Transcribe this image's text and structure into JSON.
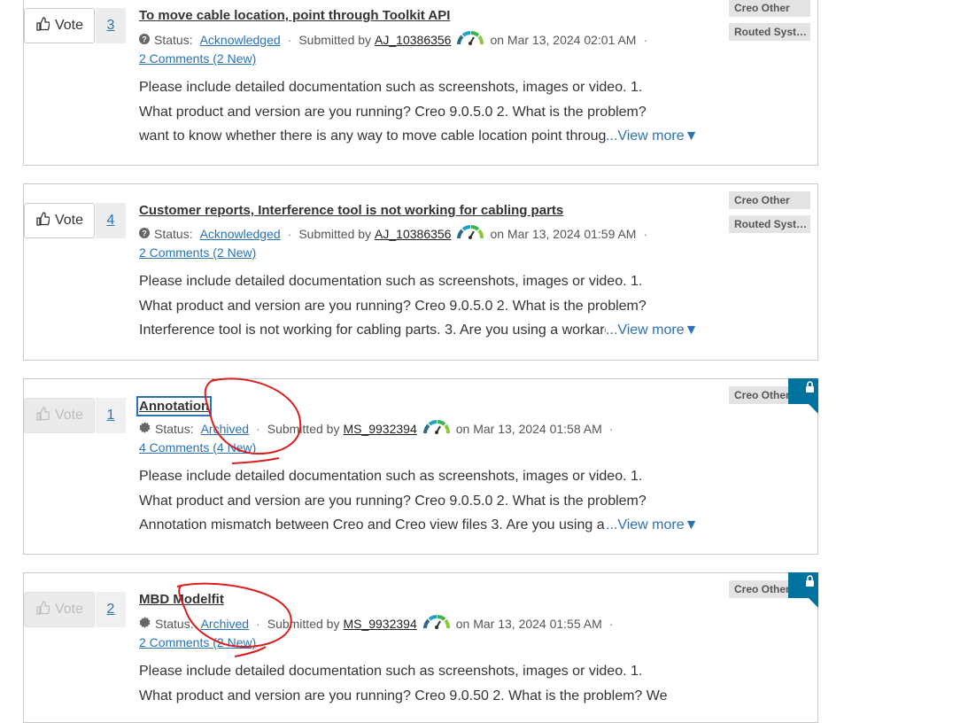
{
  "ideas": [
    {
      "vote_label": "Vote",
      "count": "3",
      "title": "To move cable location, point through Toolkit API",
      "status_label": "Status:",
      "status": "Acknowledged",
      "submitted_by_label": "Submitted by",
      "user": "AJ_10386356",
      "date": "on Mar 13, 2024 02:01 AM",
      "comments": "2 Comments (2 New)",
      "body_lines": [
        "Please include detailed documentation such as screenshots, images or video. 1.",
        "What product and version are you running? Creo 9.0.5.0 2. What is the problem?",
        "want to know whether there is any way to move cable location point through TOOLKIT"
      ],
      "view_more": "...View more",
      "labels": [
        "Creo Other",
        "Routed Systems Designer"
      ]
    },
    {
      "vote_label": "Vote",
      "count": "4",
      "title": "Customer reports, Interference tool is not working for cabling parts",
      "status_label": "Status:",
      "status": "Acknowledged",
      "submitted_by_label": "Submitted by",
      "user": "AJ_10386356",
      "date": "on Mar 13, 2024 01:59 AM",
      "comments": "2 Comments (2 New)",
      "body_lines": [
        "Please include detailed documentation such as screenshots, images or video. 1.",
        "What product and version are you running? Creo 9.0.5.0 2. What is the problem?",
        "Interference tool is not working for cabling parts. 3. Are you using a workaround"
      ],
      "view_more": "...View more",
      "labels": [
        "Creo Other",
        "Routed Systems Designer"
      ]
    },
    {
      "vote_label": "Vote",
      "count": "1",
      "title": "Annotation",
      "status_label": "Status:",
      "status": "Archived",
      "submitted_by_label": "Submitted by",
      "user": "MS_9932394",
      "date": "on Mar 13, 2024 01:58 AM",
      "comments": "4 Comments (4 New)",
      "body_lines": [
        "Please include detailed documentation such as screenshots, images or video. 1.",
        "What product and version are you running? Creo 9.0.5.0 2. What is the problem?",
        "Annotation mismatch between Creo and Creo view files 3. Are you using a workaround"
      ],
      "view_more": "...View more",
      "labels": [
        "Creo Other"
      ]
    },
    {
      "vote_label": "Vote",
      "count": "2",
      "title": "MBD Modelfit",
      "status_label": "Status:",
      "status": "Archived",
      "submitted_by_label": "Submitted by",
      "user": "MS_9932394",
      "date": "on Mar 13, 2024 01:55 AM",
      "comments": "2 Comments (2 New)",
      "body_lines": [
        "Please include detailed documentation such as screenshots, images or video. 1.",
        "What product and version are you running? Creo 9.0.50 2. What is the problem? We"
      ],
      "view_more": "",
      "labels": [
        "Creo Other"
      ]
    }
  ],
  "colors": {
    "link": "#2a72b5",
    "lock_banner": "#00729e",
    "annotation_red": "#d81e1e"
  }
}
